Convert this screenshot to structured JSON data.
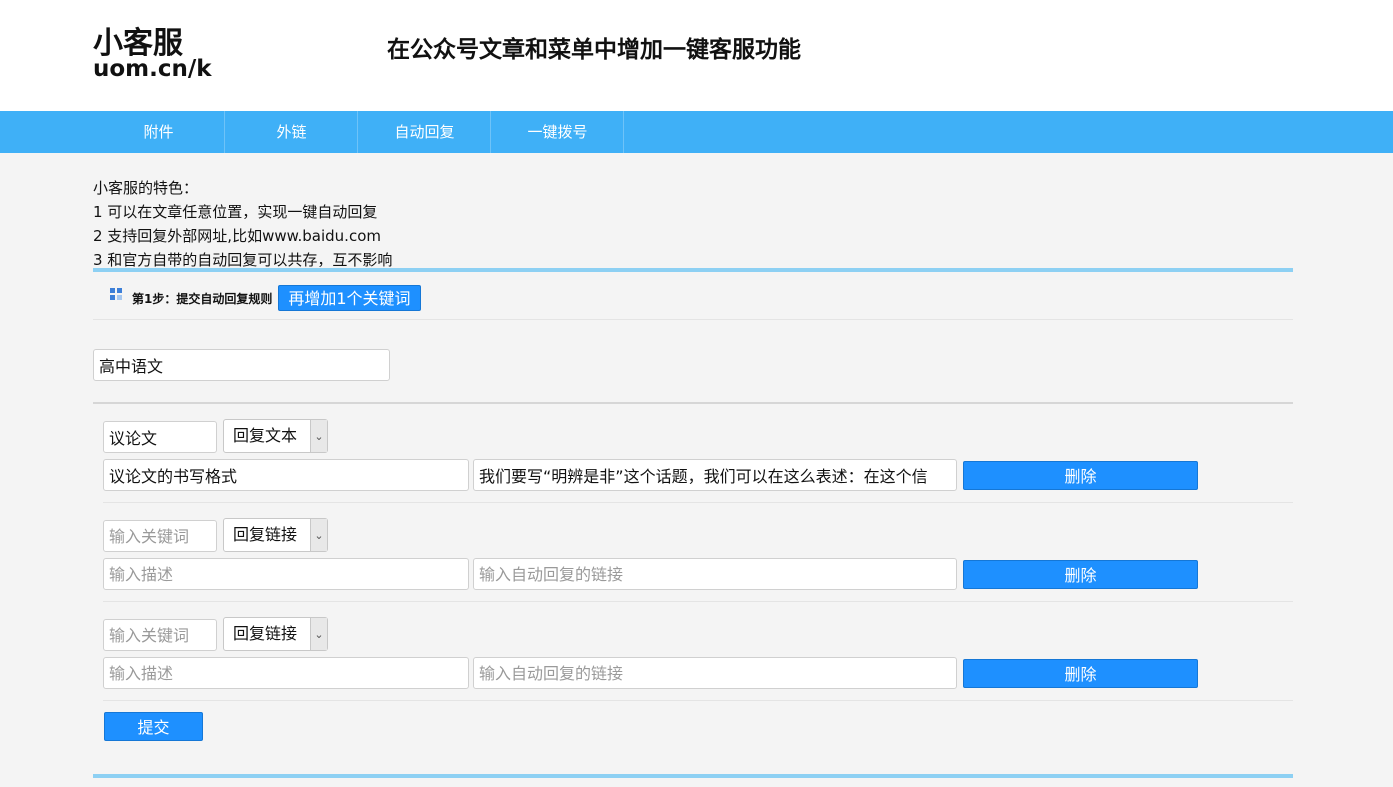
{
  "header": {
    "logo_line1": "小客服",
    "logo_line2": "uom.cn/k",
    "title": "在公众号文章和菜单中增加一键客服功能"
  },
  "nav": {
    "items": [
      "附件",
      "外链",
      "自动回复",
      "一键拨号"
    ]
  },
  "features": {
    "heading": "小客服的特色：",
    "lines": [
      "1 可以在文章任意位置，实现一键自动回复",
      "2 支持回复外部网址,比如www.baidu.com",
      "3 和官方自带的自动回复可以共存，互不影响"
    ]
  },
  "step": {
    "label": "第1步：提交自动回复规则",
    "add_button": "再增加1个关键词"
  },
  "group_name": {
    "value": "高中语文"
  },
  "rules": [
    {
      "keyword": "议论文",
      "keyword_placeholder": "输入关键词",
      "type": "回复文本",
      "description": "议论文的书写格式",
      "description_placeholder": "输入描述",
      "content": "我们要写“明辨是非”这个话题，我们可以在这么表述：在这个信",
      "content_placeholder": "输入自动回复的链接",
      "delete_label": "删除"
    },
    {
      "keyword": "",
      "keyword_placeholder": "输入关键词",
      "type": "回复链接",
      "description": "",
      "description_placeholder": "输入描述",
      "content": "",
      "content_placeholder": "输入自动回复的链接",
      "delete_label": "删除"
    },
    {
      "keyword": "",
      "keyword_placeholder": "输入关键词",
      "type": "回复链接",
      "description": "",
      "description_placeholder": "输入描述",
      "content": "",
      "content_placeholder": "输入自动回复的链接",
      "delete_label": "删除"
    }
  ],
  "submit_label": "提交",
  "icons": {
    "select_arrow": "chevron-down-icon",
    "step_icon": "grid-icon"
  },
  "colors": {
    "nav_bg": "#3fb0f7",
    "button_blue": "#1e90ff",
    "divider_blue": "#8dd0f3",
    "page_bg": "#f4f4f4"
  }
}
